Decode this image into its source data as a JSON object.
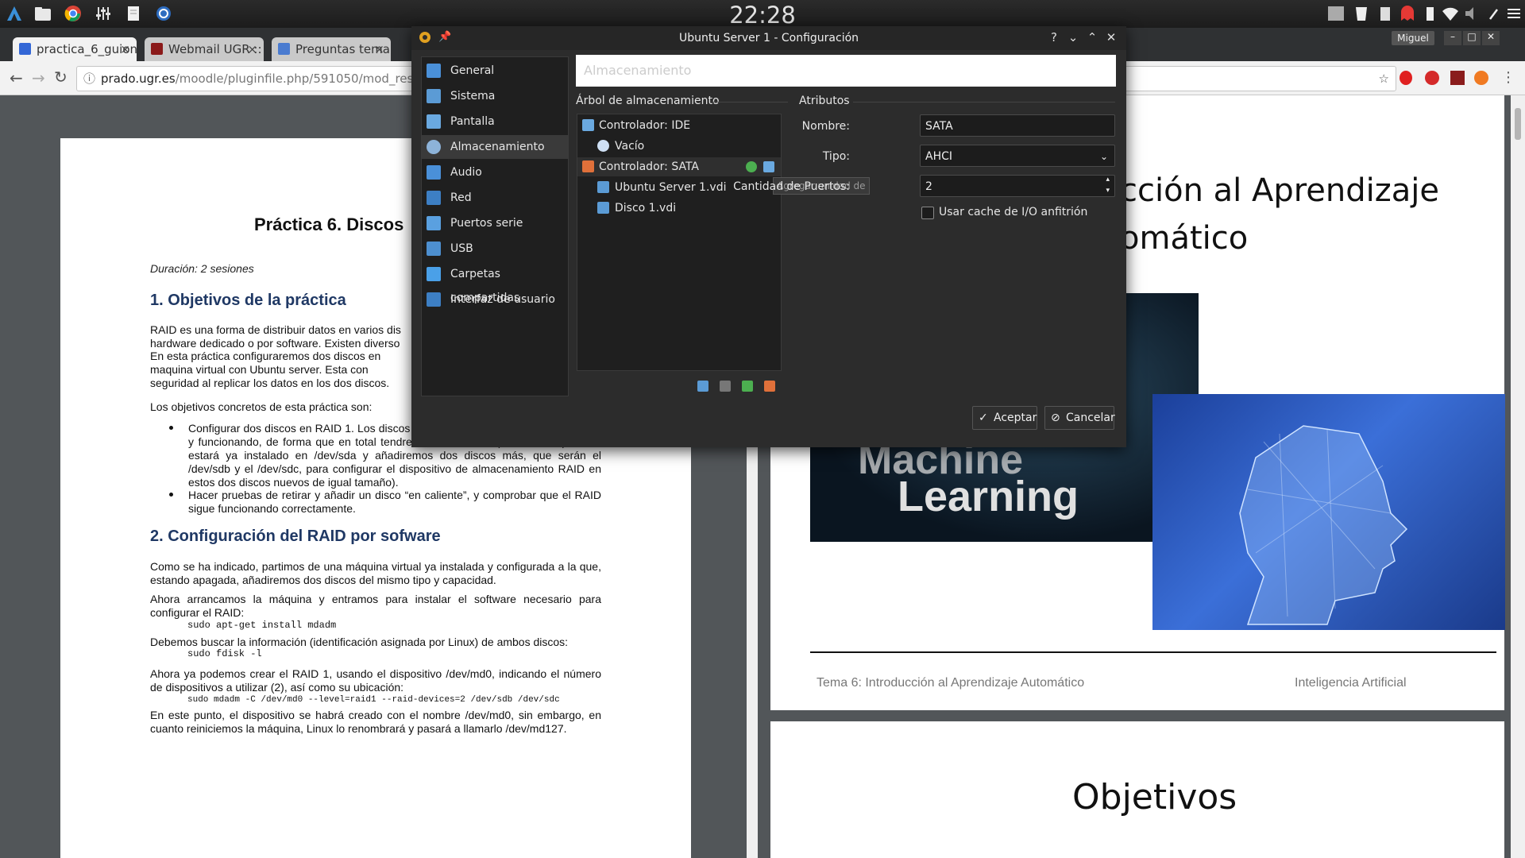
{
  "panel": {
    "clock": "22:28",
    "user": "Miguel"
  },
  "browser": {
    "tabs": [
      {
        "label": "practica_6_guion",
        "active": true
      },
      {
        "label": "Webmail UGR :: I",
        "active": false
      },
      {
        "label": "Preguntas tema",
        "active": false
      }
    ],
    "url_host": "prado.ugr.es",
    "url_path": "/moodle/pluginfile.php/591050/mod_resource"
  },
  "document": {
    "title": "Práctica 6. Discos",
    "duration": "Duración: 2 sesiones",
    "h1": "1. Objetivos de la práctica",
    "p1": "RAID es una forma de distribuir datos en varios dis",
    "p1b": "hardware dedicado o por software. Existen diverso",
    "p2": "En esta práctica configuraremos dos discos en",
    "p2b": "maquina virtual con Ubuntu server. Esta con",
    "p2c": "seguridad al replicar los datos en los dos discos.",
    "p3": "Los objetivos concretos de esta práctica son:",
    "bullet1": "Configurar dos discos en RAID 1. Los discos se añadirán a un sistema ya instalado y funcionando, de forma que en total tendremos tres discos (el sistema operativo estará ya instalado en /dev/sda y añadiremos dos discos más, que serán el /dev/sdb y el /dev/sdc, para configurar el dispositivo de almacenamiento RAID en estos dos discos nuevos de igual tamaño).",
    "bullet2": "Hacer pruebas de retirar y añadir un disco “en caliente”, y comprobar que el RAID sigue funcionando correctamente.",
    "h2": "2. Configuración del RAID por sofware",
    "p4": "Como se ha indicado, partimos de una máquina virtual ya instalada y configurada a la que, estando apagada, añadiremos dos discos del mismo tipo y capacidad.",
    "p5": "Ahora arrancamos la máquina y entramos para instalar el software necesario para configurar el RAID:",
    "cmd1": "sudo apt-get install mdadm",
    "p6": "Debemos buscar la información (identificación asignada por Linux) de ambos discos:",
    "cmd2": "sudo fdisk -l",
    "p7": "Ahora ya podemos crear el RAID 1, usando el dispositivo /dev/md0, indicando el número de dispositivos a utilizar (2), así como su ubicación:",
    "cmd3": "sudo mdadm -C /dev/md0 --level=raid1 --raid-devices=2 /dev/sdb /dev/sdc",
    "p8": "En este punto, el dispositivo se habrá creado con el nombre /dev/md0, sin embargo, en cuanto reiniciemos la máquina, Linux lo renombrará y pasará a llamarlo /dev/md127."
  },
  "slides": {
    "title_line1": "cción al Aprendizaje",
    "title_line2": "omático",
    "image_text_1": "Machine",
    "image_text_2": "Learning",
    "footer_left": "Tema 6: Introducción al Aprendizaje Automático",
    "footer_right": "Inteligencia Artificial",
    "next_title": "Objetivos"
  },
  "dialog": {
    "title": "Ubuntu Server 1 - Configuración",
    "page_title": "Almacenamiento",
    "nav": [
      {
        "label": "General",
        "icon": "general-icon",
        "color": "#4a90d9"
      },
      {
        "label": "Sistema",
        "icon": "system-icon",
        "color": "#5b9bd5"
      },
      {
        "label": "Pantalla",
        "icon": "display-icon",
        "color": "#6aa9e0"
      },
      {
        "label": "Almacenamiento",
        "icon": "storage-icon",
        "color": "#8db3d9"
      },
      {
        "label": "Audio",
        "icon": "audio-icon",
        "color": "#4a90d9"
      },
      {
        "label": "Red",
        "icon": "network-icon",
        "color": "#3d7fc4"
      },
      {
        "label": "Puertos serie",
        "icon": "serial-port-icon",
        "color": "#5aa0e0"
      },
      {
        "label": "USB",
        "icon": "usb-icon",
        "color": "#4d8fd0"
      },
      {
        "label": "Carpetas compartidas",
        "icon": "shared-folder-icon",
        "color": "#4aa0e8"
      },
      {
        "label": "Interfaz de usuario",
        "icon": "user-interface-icon",
        "color": "#3d7fc4"
      }
    ],
    "selected_nav": "Almacenamiento",
    "tree_header": "Árbol de almacenamiento",
    "tree": [
      {
        "label": "Controlador: IDE",
        "level": 0
      },
      {
        "label": "Vacío",
        "level": 1
      },
      {
        "label": "Controlador: SATA",
        "level": 0,
        "selected": true
      },
      {
        "label": "Ubuntu Server 1.vdi",
        "level": 1
      },
      {
        "label": "Disco 1.vdi",
        "level": 1
      }
    ],
    "tooltip": "Agregar unidad de",
    "attributes_header": "Atributos",
    "name_label": "Nombre:",
    "name_value": "SATA",
    "type_label": "Tipo:",
    "type_value": "AHCI",
    "ports_label": "Cantidad de Puertos:",
    "ports_value": "2",
    "cache_label": "Usar cache de I/O anfitrión",
    "cache_checked": false,
    "ok_label": "Aceptar",
    "cancel_label": "Cancelar"
  }
}
